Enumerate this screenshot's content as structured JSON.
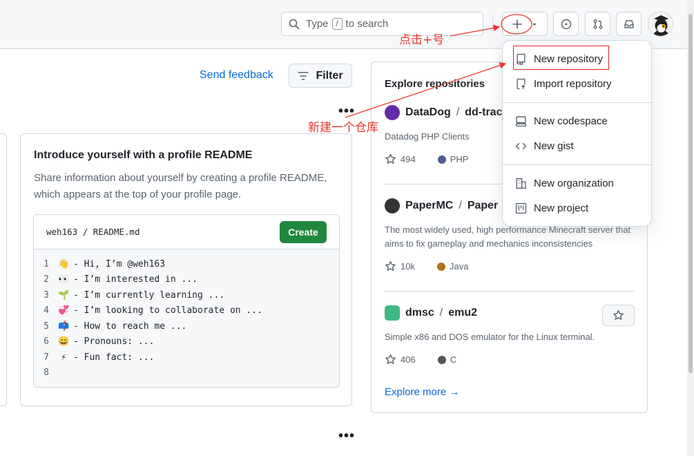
{
  "header": {
    "search": {
      "prefix": "Type",
      "key": "/",
      "suffix": "to search"
    },
    "buttons": [
      "plus-create",
      "issues",
      "pull-requests",
      "inbox"
    ]
  },
  "feed": {
    "send_feedback": "Send feedback",
    "filter_label": "Filter"
  },
  "readme_card": {
    "title": "Introduce yourself with a profile README",
    "description": "Share information about yourself by creating a profile README, which appears at the top of your profile page.",
    "path_user": "weh163",
    "path_sep": "/",
    "path_file": "README.md",
    "create_label": "Create",
    "lines": [
      {
        "num": "1",
        "emoji": "👋",
        "text": "- Hi, I’m @weh163"
      },
      {
        "num": "2",
        "emoji": "👀",
        "text": "- I’m interested in ..."
      },
      {
        "num": "3",
        "emoji": "🌱",
        "text": "- I’m currently learning ..."
      },
      {
        "num": "4",
        "emoji": "💞",
        "text": "- I’m looking to collaborate on ..."
      },
      {
        "num": "5",
        "emoji": "📫",
        "text": "- How to reach me ..."
      },
      {
        "num": "6",
        "emoji": "😄",
        "text": "- Pronouns: ..."
      },
      {
        "num": "7",
        "emoji": "⚡",
        "text": "- Fun fact: ..."
      },
      {
        "num": "8",
        "emoji": "",
        "text": ""
      }
    ]
  },
  "explore": {
    "title": "Explore repositories",
    "repos": [
      {
        "owner": "DataDog",
        "name": "dd-trace",
        "description": "Datadog PHP Clients",
        "stars": "494",
        "language": "PHP",
        "lang_color": "#4F5D95",
        "logo_color": "#632ca6"
      },
      {
        "owner": "PaperMC",
        "name": "Paper",
        "description": "The most widely used, high performance Minecraft server that aims to fix gameplay and mechanics inconsistencies",
        "stars": "10k",
        "language": "Java",
        "lang_color": "#b07219",
        "logo_color": "#333333"
      },
      {
        "owner": "dmsc",
        "name": "emu2",
        "description": "Simple x86 and DOS emulator for the Linux terminal.",
        "stars": "406",
        "language": "C",
        "lang_color": "#555555",
        "logo_color": "#3fb884"
      }
    ],
    "explore_more": "Explore more →"
  },
  "create_menu": {
    "items": [
      {
        "label": "New repository",
        "icon": "repo-icon"
      },
      {
        "label": "Import repository",
        "icon": "repo-push-icon"
      },
      {
        "label": "New codespace",
        "icon": "codespaces-icon"
      },
      {
        "label": "New gist",
        "icon": "code-icon"
      },
      {
        "label": "New organization",
        "icon": "organization-icon"
      },
      {
        "label": "New project",
        "icon": "project-icon"
      }
    ]
  },
  "annotations": {
    "click_plus": "点击+号",
    "new_repo": "新建一个仓库"
  },
  "colors": {
    "accent_link": "#0969da",
    "create_green": "#1f883d",
    "annotation_red": "#e8352a"
  }
}
